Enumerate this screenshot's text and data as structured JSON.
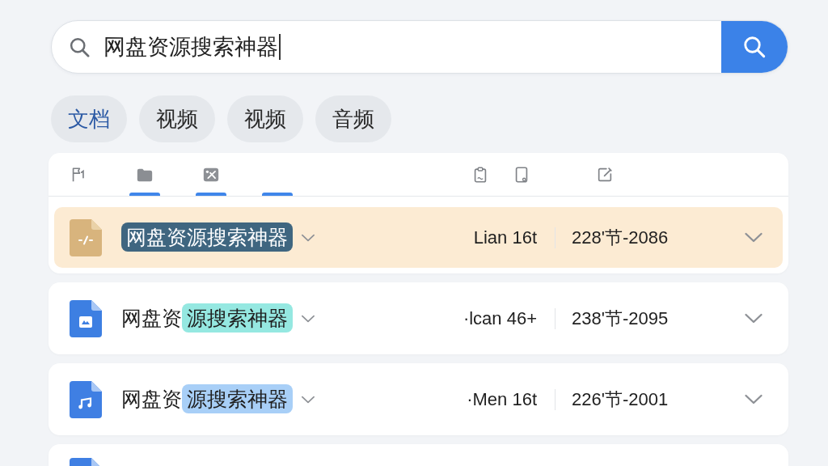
{
  "search": {
    "value": "网盘资源搜索神器",
    "focused": true
  },
  "tabs": [
    {
      "label": "文档",
      "selected": true
    },
    {
      "label": "视频",
      "selected": false
    },
    {
      "label": "视频",
      "selected": false
    },
    {
      "label": "音频",
      "selected": false
    }
  ],
  "toolbar": [
    {
      "kind": "flag",
      "selected": false
    },
    {
      "kind": "folder",
      "selected": true
    },
    {
      "kind": "image",
      "selected": true
    },
    {
      "kind": "blank",
      "selected": true
    },
    {
      "kind": "clipboard",
      "selected": false
    },
    {
      "kind": "tablet",
      "selected": false
    },
    {
      "kind": "edit",
      "selected": false
    }
  ],
  "results": [
    {
      "kind": "code",
      "title_parts": [
        {
          "text": "网盘资源搜索神器",
          "color": "#3f6680"
        }
      ],
      "author": "Lian 16t",
      "date": "228'节-2086",
      "selected": true
    },
    {
      "kind": "image",
      "title_parts": [
        {
          "text": "网盘资"
        },
        {
          "text": "源搜索神器",
          "color": "#95e8e1"
        }
      ],
      "author": "·lcan 46+",
      "date": "238'节-2095",
      "selected": false
    },
    {
      "kind": "audio",
      "title_parts": [
        {
          "text": "网盘资"
        },
        {
          "text": "源搜索神器",
          "color": "#a8cff7"
        }
      ],
      "author": "·Men 16t",
      "date": "226'节-2001",
      "selected": false
    },
    {
      "kind": "document",
      "selected": false
    }
  ]
}
